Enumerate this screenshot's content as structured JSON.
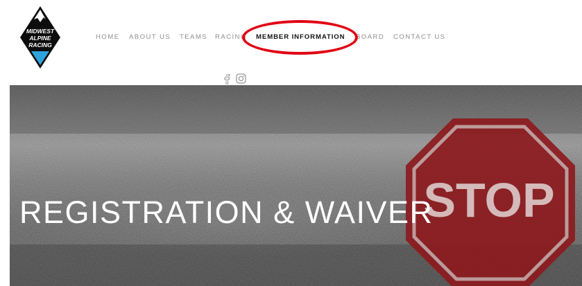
{
  "logo": {
    "line1": "MIDWEST",
    "line2": "ALPINE",
    "line3": "RACING"
  },
  "nav": {
    "items": [
      {
        "label": "HOME"
      },
      {
        "label": "ABOUT US"
      },
      {
        "label": "TEAMS"
      },
      {
        "label": "RACING"
      },
      {
        "label": "MEMBER INFORMATION",
        "active": true
      },
      {
        "label": "BOARD"
      },
      {
        "label": "CONTACT US"
      }
    ]
  },
  "social": {
    "icons": [
      "facebook-icon",
      "instagram-icon"
    ]
  },
  "hero": {
    "title": "REGISTRATION & WAIVER",
    "sign_text": "STOP"
  },
  "colors": {
    "highlight_ring": "#e10012",
    "stop_sign": "#8c1a1e",
    "logo_light_blue": "#2ea3dc",
    "nav_text": "#8e8e8e",
    "nav_active": "#111111"
  }
}
